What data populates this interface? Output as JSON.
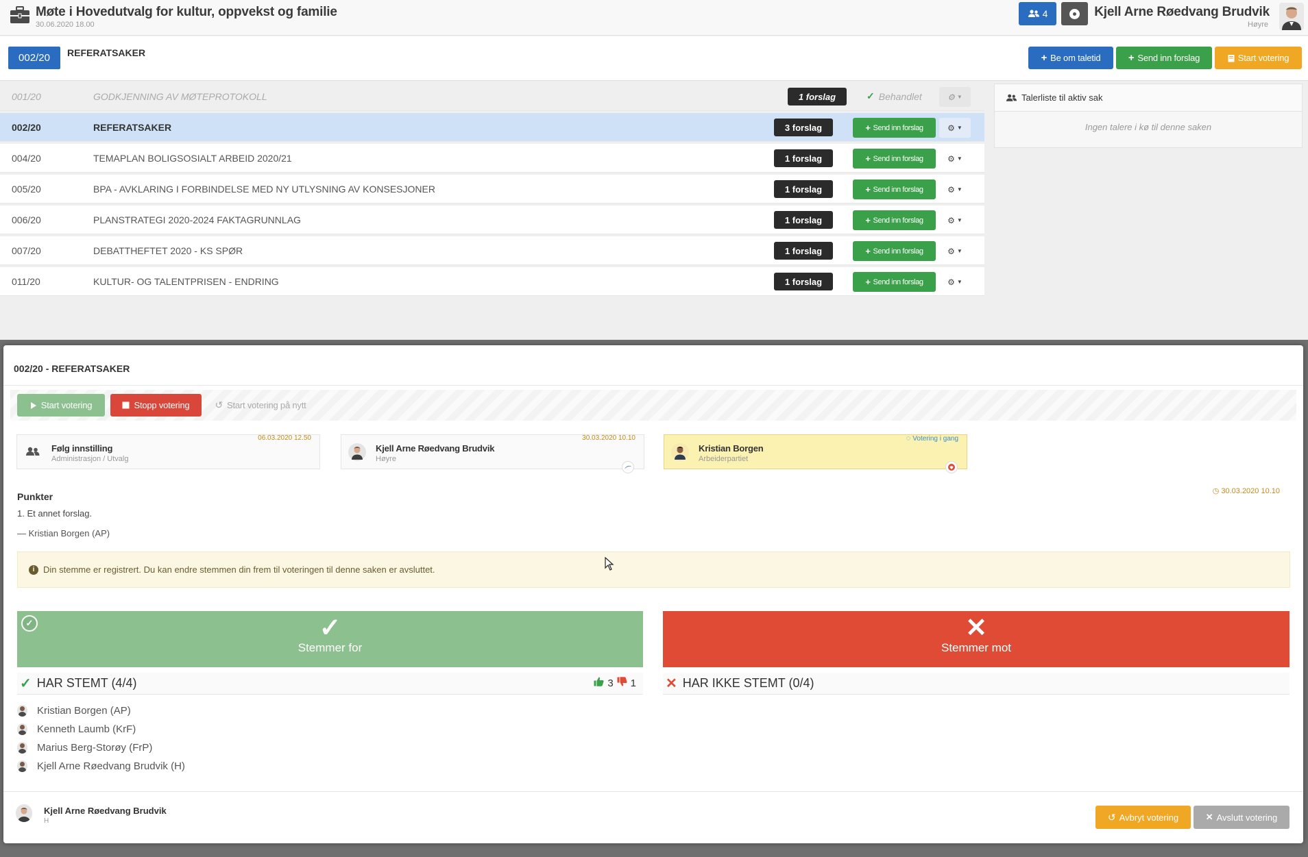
{
  "header": {
    "meeting_title": "Møte i Hovedutvalg for kultur, oppvekst og familie",
    "meeting_date": "30.06.2020 18.00",
    "users_count": "4",
    "user_name": "Kjell Arne Røedvang Brudvik",
    "user_party": "Høyre"
  },
  "case_bar": {
    "badge": "002/20",
    "title": "REFERATSAKER",
    "btn_taletid": "Be om taletid",
    "btn_send": "Send inn forslag",
    "btn_votering": "Start votering"
  },
  "agenda": [
    {
      "num": "001/20",
      "title": "GODKJENNING AV MØTEPROTOKOLL",
      "forslag": "1 forslag",
      "status": "Behandlet"
    },
    {
      "num": "002/20",
      "title": "REFERATSAKER",
      "forslag": "3 forslag",
      "send": "Send inn forslag"
    },
    {
      "num": "004/20",
      "title": "TEMAPLAN BOLIGSOSIALT ARBEID 2020/21",
      "forslag": "1 forslag",
      "send": "Send inn forslag"
    },
    {
      "num": "005/20",
      "title": "BPA - AVKLARING I FORBINDELSE MED NY UTLYSNING AV KONSESJONER",
      "forslag": "1 forslag",
      "send": "Send inn forslag"
    },
    {
      "num": "006/20",
      "title": "PLANSTRATEGI 2020-2024 FAKTAGRUNNLAG",
      "forslag": "1 forslag",
      "send": "Send inn forslag"
    },
    {
      "num": "007/20",
      "title": "DEBATTHEFTET 2020 - KS SPØR",
      "forslag": "1 forslag",
      "send": "Send inn forslag"
    },
    {
      "num": "011/20",
      "title": "KULTUR- OG TALENTPRISEN - ENDRING",
      "forslag": "1 forslag",
      "send": "Send inn forslag"
    }
  ],
  "talerliste": {
    "title": "Talerliste til aktiv sak",
    "empty": "Ingen talere i kø til denne saken"
  },
  "modal": {
    "title": "002/20 - REFERATSAKER",
    "toolbar": {
      "start": "Start votering",
      "stop": "Stopp votering",
      "restart": "Start votering på nytt"
    },
    "proposals": [
      {
        "name": "Følg innstilling",
        "sub": "Administrasjon / Utvalg",
        "date": "06.03.2020 12.50"
      },
      {
        "name": "Kjell Arne Røedvang Brudvik",
        "sub": "Høyre",
        "date": "30.03.2020 10.10"
      },
      {
        "name": "Kristian Borgen",
        "sub": "Arbeiderpartiet",
        "status": "Votering i gang"
      }
    ],
    "punkter_label": "Punkter",
    "punkter_date": "30.03.2020 10.10",
    "point_text": "1. Et annet forslag.",
    "author": "— Kristian Borgen (AP)",
    "notice": "Din stemme er registrert. Du kan endre stemmen din frem til voteringen til denne saken er avsluttet.",
    "vote_for": "Stemmer for",
    "vote_mot": "Stemmer mot",
    "har_stemt": "HAR STEMT (4/4)",
    "har_ikke_stemt": "HAR IKKE STEMT (0/4)",
    "tally_for": "3",
    "tally_mot": "1",
    "voters": [
      "Kristian Borgen (AP)",
      "Kenneth Laumb (KrF)",
      "Marius Berg-Storøy (FrP)",
      "Kjell Arne Røedvang Brudvik (H)"
    ],
    "footer": {
      "name": "Kjell Arne Røedvang Brudvik",
      "party": "H",
      "btn_avbryt": "Avbryt votering",
      "btn_avslutt": "Avslutt votering"
    }
  },
  "colors": {
    "blue": "#2a6cc0",
    "green": "#3aa14a",
    "orange": "#f0a824",
    "red": "#e04b36",
    "vote_for_green": "#8cc08e",
    "active_row": "#cfe1f7",
    "active_card": "#fbf1b0"
  },
  "icons": [
    "briefcase-icon",
    "users-icon",
    "record-icon",
    "plus-icon",
    "check-icon",
    "gear-icon",
    "caret-down-icon",
    "play-icon",
    "stop-icon",
    "history-icon",
    "info-icon",
    "clock-icon",
    "thumbs-up-icon",
    "thumbs-down-icon",
    "times-icon",
    "undo-icon"
  ]
}
